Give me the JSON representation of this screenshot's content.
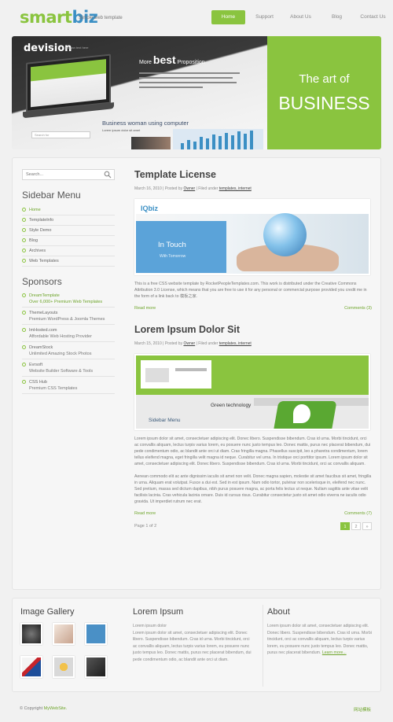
{
  "header": {
    "logo_part1": "smart",
    "logo_part2": "biz",
    "tagline": "Simple web template",
    "nav": [
      "Home",
      "Support",
      "About Us",
      "Blog",
      "Contact Us"
    ]
  },
  "banner": {
    "brand": "devision",
    "brand_sub": "slogan text here",
    "proposition_more": "More",
    "proposition_best": "best",
    "proposition_tail": "Proposition",
    "headline": "Business woman using computer",
    "headline_sub": "Lorem ipsum dolor sit amet",
    "search_text": "Search for",
    "art_line1": "The art of",
    "art_line2": "BUSINESS"
  },
  "sidebar": {
    "search_placeholder": "Search...",
    "menu_title": "Sidebar Menu",
    "menu_items": [
      "Home",
      "Templatelnfo",
      "Style Demo",
      "Blog",
      "Archives",
      "Web Templates"
    ],
    "sponsors_title": "Sponsors",
    "sponsors": [
      {
        "name": "DreamTemplate",
        "desc": "Over 6,000+ Premium Web Templates"
      },
      {
        "name": "ThemeLayouts",
        "desc": "Premium WordPress & Joomla Themes"
      },
      {
        "name": "ImHosted.com",
        "desc": "Affordable Web Hosting Provider"
      },
      {
        "name": "DreamStock",
        "desc": "Unlimited Amazing Stock Photos"
      },
      {
        "name": "Evrsoft",
        "desc": "Website Builder Software & Tools"
      },
      {
        "name": "CSS Hub",
        "desc": "Premium CSS Templates"
      }
    ]
  },
  "posts": [
    {
      "title": "Template License",
      "date": "March 16, 2010",
      "by_label": "Posted by",
      "author": "Owner",
      "filed_label": "Filed under",
      "tags": "templates, internet",
      "image": {
        "brand": "IQbiz",
        "line1": "In Touch",
        "line2": "With Tomorrow"
      },
      "paragraphs": [
        "This is a free CSS website template by RocketPeopleTemplates.com. This work is distributed under the Creative Commons Attribution 3.0 License, which means that you are free to use it for any personal or commercial purpose provided you credit me in the form of a link back to 模板之家."
      ],
      "read_more": "Read more",
      "comments": "Comments (3)"
    },
    {
      "title": "Lorem Ipsum Dolor Sit",
      "date": "March 15, 2010",
      "by_label": "Posted by",
      "author": "Owner",
      "filed_label": "Filed under",
      "tags": "templates, internet",
      "image": {
        "caption1": "Green technology",
        "caption2": "Sidebar Menu"
      },
      "paragraphs": [
        "Lorem ipsum dolor sit amet, consectetuer adipiscing elit. Donec libero. Suspendisse bibendum. Cras id urna. Morbi tincidunt, orci ac convallis aliquam, lectus turpis varius lorem, eu posuere nunc justo tempus leo. Donec mattis, purus nec placerat bibendum, dui pede condimentum odio, ac blandit ante orci ut diam. Cras fringilla magna. Phasellus suscipit, leo a pharetra condimentum, lorem tellus eleifend magna, eget fringilla velit magna id neque. Curabitur vel urna. In tristique orci porttitor ipsum. Lorem ipsum dolor sit amet, consectetuer adipiscing elit. Donec libero. Suspendisse bibendum. Cras id urna. Morbi tincidunt, orci ac convallis aliquam.",
        "Aenean commodo elit ac ante dignissim iaculis sit amet non velit. Donec magna sapien, molestie sit amet faucibus sit amet, fringilla in urna. Aliquam erat volutpat. Fusce a dui est. Sed in est ipsum. Nam odio tortor, pulvinar non scelerisque in, eleifend nec nunc. Sed pretium, massa sed dictum dapibus, nibh purus posuere magna, ac porta felis lectus ut neque. Nullam sagittis ante vitae velit facilisis lacinia. Cras vehicula lacinia ornare. Duis id cursus risus. Curabitur consectetur justo sit amet odio viverra ne iaculis odio gravida. Ut imperdiet rutrum nec erat."
      ],
      "read_more": "Read more",
      "comments": "Comments (7)"
    }
  ],
  "pagination": {
    "label": "Page 1 of 2",
    "pages": [
      "1",
      "2",
      "»"
    ]
  },
  "footer": {
    "gallery_title": "Image Gallery",
    "lorem_title": "Lorem Ipsum",
    "lorem_text1": "Lorem ipsum dolor",
    "lorem_text2": "Lorem ipsum dolor sit amet, consectetuer adipiscing elit. Donec libero. Suspendisse bibendum. Cras id urna. Morbi tincidunt, orci ac convallis aliquam, lectus turpis varius lorem, eu posuere nunc justo tempus leo. Donec mattis, purus nec placerat bibendum, dui pede condimentum odio, ac blandit ante orci ut diam.",
    "about_title": "About",
    "about_text": "Lorem ipsum dolor sit amet, consectetuer adipiscing elit. Donec libero. Suspendisse bibendum. Cras id urna. Morbi tincidunt, orci ac convallis aliquam, lectus turpis varius lorem, eu posuere nunc justo tempus leo. Donec mattis, purus nec placerat bibendum.",
    "learn_more": "Learn more..."
  },
  "bottom": {
    "copyright": "© Copyright",
    "site": "MyWebSite.",
    "right_link": "网站模板"
  },
  "colors": {
    "accent": "#8ac43f",
    "logo_blue": "#3b8fc4",
    "background": "#f1f1f1"
  }
}
